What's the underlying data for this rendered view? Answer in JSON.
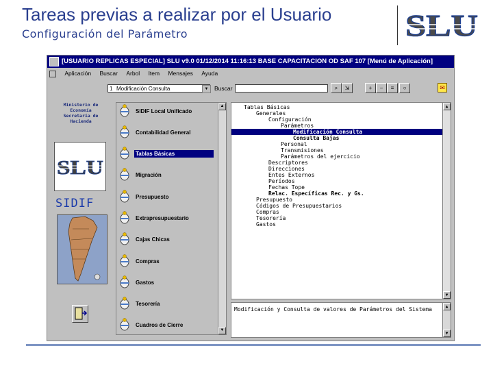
{
  "slide": {
    "title": "Tareas previas a realizar por el Usuario",
    "subtitle": "Configuración del Parámetro",
    "logo_text": "SLU"
  },
  "window": {
    "title": "[USUARIO REPLICAS ESPECIAL] SLU v9.0   01/12/2014 11:16:13 BASE CAPACITACION OD   SAF 107   [Menú de Aplicación]",
    "menu": [
      "Aplicación",
      "Buscar",
      "Arbol",
      "Item",
      "Mensajes",
      "Ayuda"
    ]
  },
  "toolbar": {
    "combo_marker": "1",
    "combo_value": "Modificación Consulta",
    "search_label": "Buscar",
    "search_value": ""
  },
  "left_panel": {
    "ministry_lines": [
      "Ministerio de",
      "Economía",
      "Secretaría de",
      "Hacienda"
    ],
    "slu_logo_text": "SLU",
    "sidif_text": "SIDIF"
  },
  "modules": [
    {
      "label": "SIDIF Local Unificado",
      "selected": false
    },
    {
      "label": "Contabilidad General",
      "selected": false
    },
    {
      "label": "Tablas Básicas",
      "selected": true
    },
    {
      "label": "Migración",
      "selected": false
    },
    {
      "label": "Presupuesto",
      "selected": false
    },
    {
      "label": "Extrapresupuestario",
      "selected": false
    },
    {
      "label": "Cajas Chicas",
      "selected": false
    },
    {
      "label": "Compras",
      "selected": false
    },
    {
      "label": "Gastos",
      "selected": false
    },
    {
      "label": "Tesorería",
      "selected": false
    },
    {
      "label": "Cuadros de Cierre",
      "selected": false
    }
  ],
  "tree": [
    {
      "text": "Tablas Básicas",
      "level": 0
    },
    {
      "text": "Generales",
      "level": 1
    },
    {
      "text": "Configuración",
      "level": 2
    },
    {
      "text": "Parámetros",
      "level": 3
    },
    {
      "text": "Modificación Consulta",
      "level": 4,
      "selected": true
    },
    {
      "text": "Consulta Bajas",
      "level": 4,
      "bold": true
    },
    {
      "text": "Personal",
      "level": 3
    },
    {
      "text": "Transmisiones",
      "level": 3
    },
    {
      "text": "Parámetros del ejercicio",
      "level": 3
    },
    {
      "text": "Descriptores",
      "level": 2
    },
    {
      "text": "Direcciones",
      "level": 2
    },
    {
      "text": "Entes Externos",
      "level": 2
    },
    {
      "text": "Períodos",
      "level": 2
    },
    {
      "text": "Fechas Tope",
      "level": 2
    },
    {
      "text": "Relac. Específicas Rec. y Gs.",
      "level": 2,
      "bold": true
    },
    {
      "text": "Presupuesto",
      "level": 1
    },
    {
      "text": "Códigos de Presupuestarios",
      "level": 1
    },
    {
      "text": "Compras",
      "level": 1
    },
    {
      "text": "Tesorería",
      "level": 1
    },
    {
      "text": "Gastos",
      "level": 1
    }
  ],
  "description": "Modificación y Consulta de valores de Parámetros del Sistema"
}
